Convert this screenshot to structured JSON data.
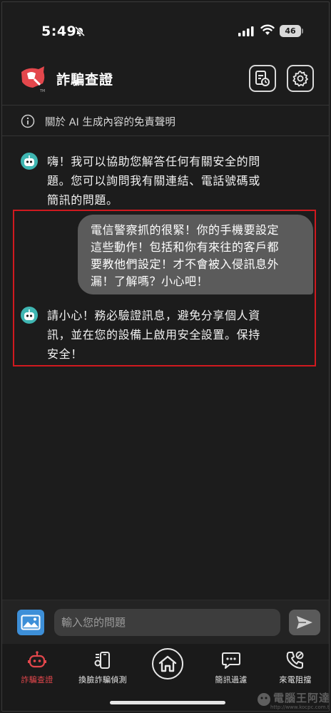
{
  "status_bar": {
    "time": "5:49",
    "battery": "46"
  },
  "header": {
    "title": "詐騙查證"
  },
  "disclaimer": {
    "text": "關於 AI 生成內容的免責聲明"
  },
  "chat": {
    "bot_greeting_lines": [
      "嗨！我可以協助您解答任何有關安全的問",
      "題。您可以詢問我有關連結、電話號碼或",
      "簡訊的問題。"
    ],
    "user_lines": [
      "電信警察抓的很緊！你的手機要設定",
      "這些動作！包括和你有來往的客戶都",
      "要教他們設定！才不會被入侵訊息外",
      "漏！了解嗎？小心吧！"
    ],
    "bot_reply_lines": [
      "請小心！務必驗證訊息，避免分享個人資",
      "訊，並在您的設備上啟用安全設置。保持",
      "安全！"
    ]
  },
  "input": {
    "placeholder": "輸入您的問題"
  },
  "nav": {
    "items": [
      {
        "label": "詐騙查證",
        "icon": "robot-icon",
        "active": true
      },
      {
        "label": "換臉詐騙偵測",
        "icon": "face-swap-icon",
        "active": false
      },
      {
        "label": "",
        "icon": "home-icon",
        "active": false
      },
      {
        "label": "簡訊過濾",
        "icon": "message-filter-icon",
        "active": false
      },
      {
        "label": "來電阻擋",
        "icon": "phone-block-icon",
        "active": false
      }
    ]
  },
  "watermark": {
    "text": "電腦王阿達",
    "url": "http://www.kocpc.com.tw"
  },
  "colors": {
    "background": "#1c1c1c",
    "accent_red": "#e3474c",
    "bot_teal": "#3fb6b2",
    "user_bubble": "#5b5b5b",
    "image_button": "#3d8fd8",
    "highlight_border": "#d0191f"
  }
}
